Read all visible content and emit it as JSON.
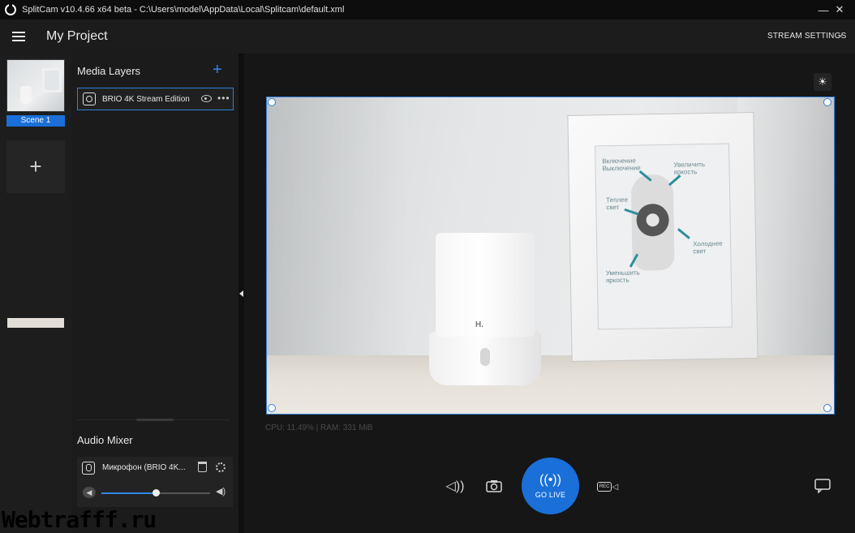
{
  "window": {
    "title": "SplitCam v10.4.66 x64 beta - C:\\Users\\model\\AppData\\Local\\Splitcam\\default.xml",
    "minimize": "—",
    "close": "✕"
  },
  "header": {
    "project_title": "My Project",
    "stream_settings": "STREAM SETTINGS",
    "chevron": "⌄"
  },
  "scenes": {
    "items": [
      {
        "label": "Scene 1"
      }
    ],
    "add": "+"
  },
  "media_layers": {
    "title": "Media Layers",
    "add": "+",
    "items": [
      {
        "name": "BRIO 4K Stream Edition",
        "more": "•••"
      }
    ]
  },
  "audio_mixer": {
    "title": "Audio Mixer",
    "items": [
      {
        "name": "Микрофон (BRIO 4K...",
        "volume": 0.5
      }
    ]
  },
  "preview": {
    "logo": "H.",
    "labels": {
      "on_off": "Включение\nВыключение",
      "brighter": "Увеличить\nяркость",
      "warm": "Теплее\nсвет",
      "cold": "Холоднее\nсвет",
      "dimmer": "Уменьшить\nяркость"
    }
  },
  "stats": "CPU: 11.49% | RAM: 331 MiB",
  "controls": {
    "go_live": "GO LIVE",
    "rec": "REC"
  },
  "watermark": "Webtrafff.ru",
  "colors": {
    "accent": "#1a6fd9",
    "selection": "#2f7fd9"
  }
}
